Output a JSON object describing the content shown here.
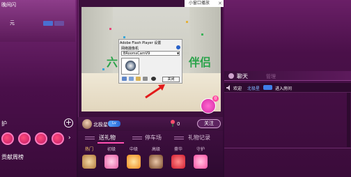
{
  "left_panel": {
    "top_title": "晚间闪",
    "price": "元",
    "guard_label": "护",
    "rank_label": "贡献周榜"
  },
  "video": {
    "pip_label": "小窗口播放",
    "banner_left": "六",
    "banner_right": "伴侣"
  },
  "flash_dialog": {
    "title": "Adobe Flash Player 设置",
    "label": "网络摄像机",
    "selected_camera": "BRoomsCamV9",
    "close_label": "关闭"
  },
  "host": {
    "name": "北极星",
    "level": "Lv",
    "flower_count": "0",
    "follow_label": "关注",
    "rose_count": "0"
  },
  "gift_panel": {
    "tabs": [
      "送礼物",
      "停车场",
      "礼物记录"
    ],
    "subtabs": [
      "热门",
      "初级",
      "中级",
      "高级",
      "豪华",
      "守护"
    ]
  },
  "chat": {
    "tab_label": "聊天",
    "admin_label": "管理",
    "welcome_prefix": "欢迎",
    "user": "北极星",
    "message": "进入房间"
  },
  "colors": {
    "accent": "#ff4fb0",
    "background": "#3a0c3a",
    "link": "#7fb4ff"
  }
}
